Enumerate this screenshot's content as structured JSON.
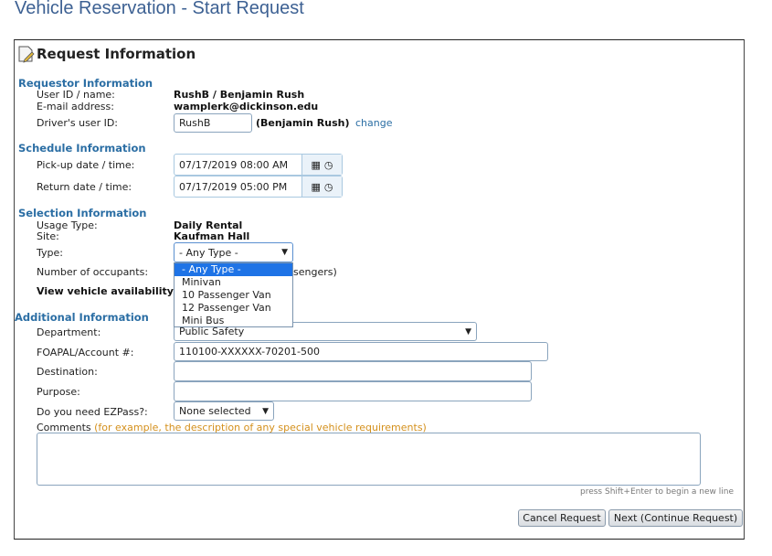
{
  "page_title": "Vehicle Reservation - Start Request",
  "panel_title": "Request Information",
  "requestor": {
    "header": "Requestor Information",
    "user_label": "User ID / name:",
    "user_value": "RushB / Benjamin Rush",
    "email_label": "E-mail address:",
    "email_value": "wamplerk@dickinson.edu",
    "driver_label": "Driver's user ID:",
    "driver_value": "RushB",
    "driver_name": "(Benjamin Rush)",
    "change_link": "change"
  },
  "schedule": {
    "header": "Schedule Information",
    "pickup_label": "Pick-up date / time:",
    "pickup_value": "07/17/2019 08:00 AM",
    "return_label": "Return date / time:",
    "return_value": "07/17/2019 05:00 PM"
  },
  "selection": {
    "header": "Selection Information",
    "usage_label": "Usage Type:",
    "usage_value": "Daily Rental",
    "site_label": "Site:",
    "site_value": "Kaufman Hall",
    "type_label": "Type:",
    "type_value": "- Any Type -",
    "type_options": [
      "- Any Type -",
      "Minivan",
      "10 Passenger Van",
      "12 Passenger Van",
      "Mini Bus"
    ],
    "occupants_label": "Number of occupants:",
    "occupants_suffix": "sengers)",
    "availability": "View vehicle availability"
  },
  "additional": {
    "header": "Additional Information",
    "department_label": "Department:",
    "department_value": "Public Safety",
    "foapal_label": "FOAPAL/Account #:",
    "foapal_value": "110100-XXXXXX-70201-500",
    "destination_label": "Destination:",
    "destination_value": "",
    "purpose_label": "Purpose:",
    "purpose_value": "",
    "ezpass_label": "Do you need EZPass?:",
    "ezpass_value": "None selected",
    "comments_label": "Comments",
    "comments_hint": "(for example, the description of any special vehicle requirements)",
    "comments_value": "",
    "newline_hint": "press Shift+Enter to begin a new line"
  },
  "buttons": {
    "cancel": "Cancel Request",
    "next": "Next (Continue Request)"
  },
  "colors": {
    "section": "#2b6ea4",
    "highlight": "#1e73e6",
    "hint": "#d4901c"
  }
}
